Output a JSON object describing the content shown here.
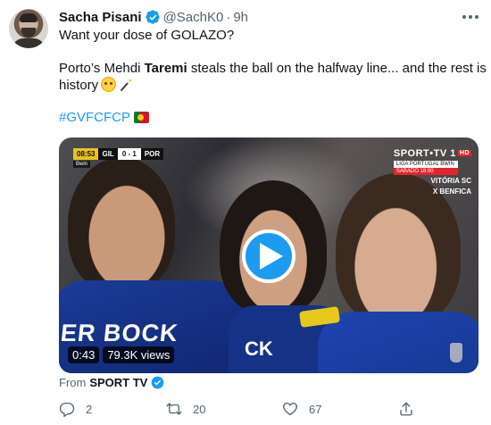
{
  "tweet": {
    "author_name": "Sacha Pisani",
    "handle": "@SachK0",
    "separator": "·",
    "time": "9h",
    "line1": "Want your dose of GOLAZO?",
    "line2_pre": "Porto’s Mehdi ",
    "line2_bold": "Taremi",
    "line2_post": " steals the ball on the halfway line... and the rest is",
    "line3": "history",
    "hashtag": "#GVFCFCP",
    "icons": [
      "verified-icon",
      "more-icon",
      "flushed-emoji",
      "magic-wand-emoji",
      "portugal-flag"
    ]
  },
  "video": {
    "duration": "0:43",
    "views": "79.3K views",
    "scorebug": {
      "time": "08:53",
      "home": "GIL",
      "score": "0 - 1",
      "away": "POR",
      "sub": "Bwin"
    },
    "broadcaster": {
      "logo": "SPORT•TV",
      "channel": "1",
      "hd": "HD",
      "league": "LIGA PORTUGAL BWIN",
      "slot": "SÁBADO 18:00",
      "team1": "VITÓRIA SC",
      "team2": "X BENFICA"
    },
    "shirt_text_1": "ER BOCK",
    "shirt_text_2": "CK",
    "play_icon": "play-icon"
  },
  "source": {
    "prefix": "From",
    "name": "SPORT TV"
  },
  "actions": {
    "reply_count": "2",
    "retweet_count": "20",
    "like_count": "67"
  },
  "colors": {
    "accent": "#1d9bf0",
    "text": "#0f1419",
    "muted": "#536471"
  }
}
